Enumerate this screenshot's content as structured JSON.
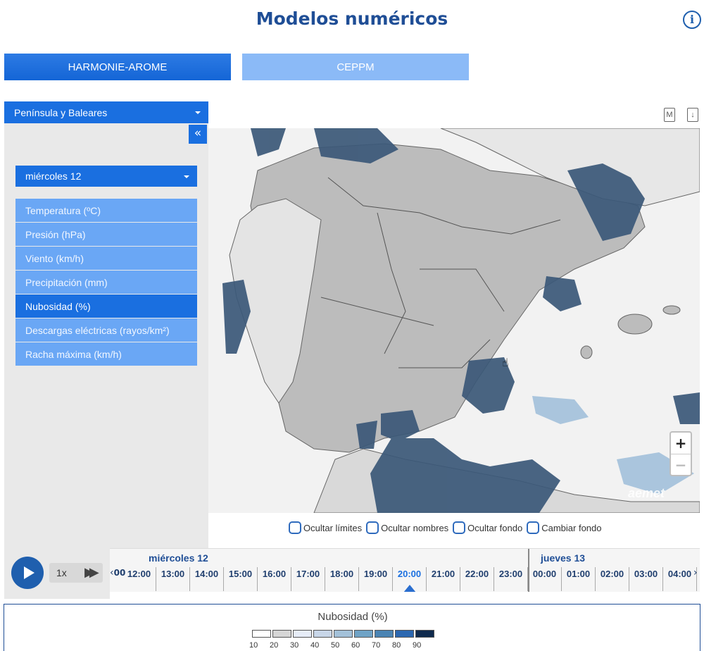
{
  "header": {
    "title": "Modelos numéricos",
    "info_icon": "info-icon"
  },
  "models": {
    "tab_a": "HARMONIE-AROME",
    "tab_b": "CEPPM",
    "selected": "HARMONIE-AROME"
  },
  "region": {
    "selected": "Península y Baleares"
  },
  "sidebar": {
    "collapse_label": "«",
    "day_selected": "miércoles 12"
  },
  "variables": [
    "Temperatura (ºC)",
    "Presión (hPa)",
    "Viento (km/h)",
    "Precipitación (mm)",
    "Nubosidad (%)",
    "Descargas eléctricas (rayos/km²)",
    "Racha máxima (km/h)"
  ],
  "active_variable": "Nubosidad (%)",
  "map_tools": {
    "m_label": "M",
    "download_label": "↓"
  },
  "zoom": {
    "in": "+",
    "out": "−"
  },
  "logo": "aemet",
  "checkboxes": {
    "hide_limits": "Ocultar límites",
    "hide_names": "Ocultar nombres",
    "hide_background": "Ocultar fondo",
    "change_background": "Cambiar fondo"
  },
  "player": {
    "speed": "1x"
  },
  "timeline": {
    "day1": "miércoles 12",
    "day2": "jueves 13",
    "partial_left": "00",
    "hours": [
      "12:00",
      "13:00",
      "14:00",
      "15:00",
      "16:00",
      "17:00",
      "18:00",
      "19:00",
      "20:00",
      "21:00",
      "22:00",
      "23:00",
      "00:00",
      "01:00",
      "02:00",
      "03:00",
      "04:00"
    ],
    "current": "20:00"
  },
  "legend": {
    "title": "Nubosidad (%)",
    "ticks": [
      "10",
      "20",
      "30",
      "40",
      "50",
      "60",
      "70",
      "80",
      "90"
    ],
    "colors": [
      "#ffffff",
      "#d6d6d6",
      "#e6ecf7",
      "#c8d6e8",
      "#a3c1d9",
      "#6fa3c6",
      "#4a84b3",
      "#2b67b0",
      "#0f2a4d"
    ]
  }
}
